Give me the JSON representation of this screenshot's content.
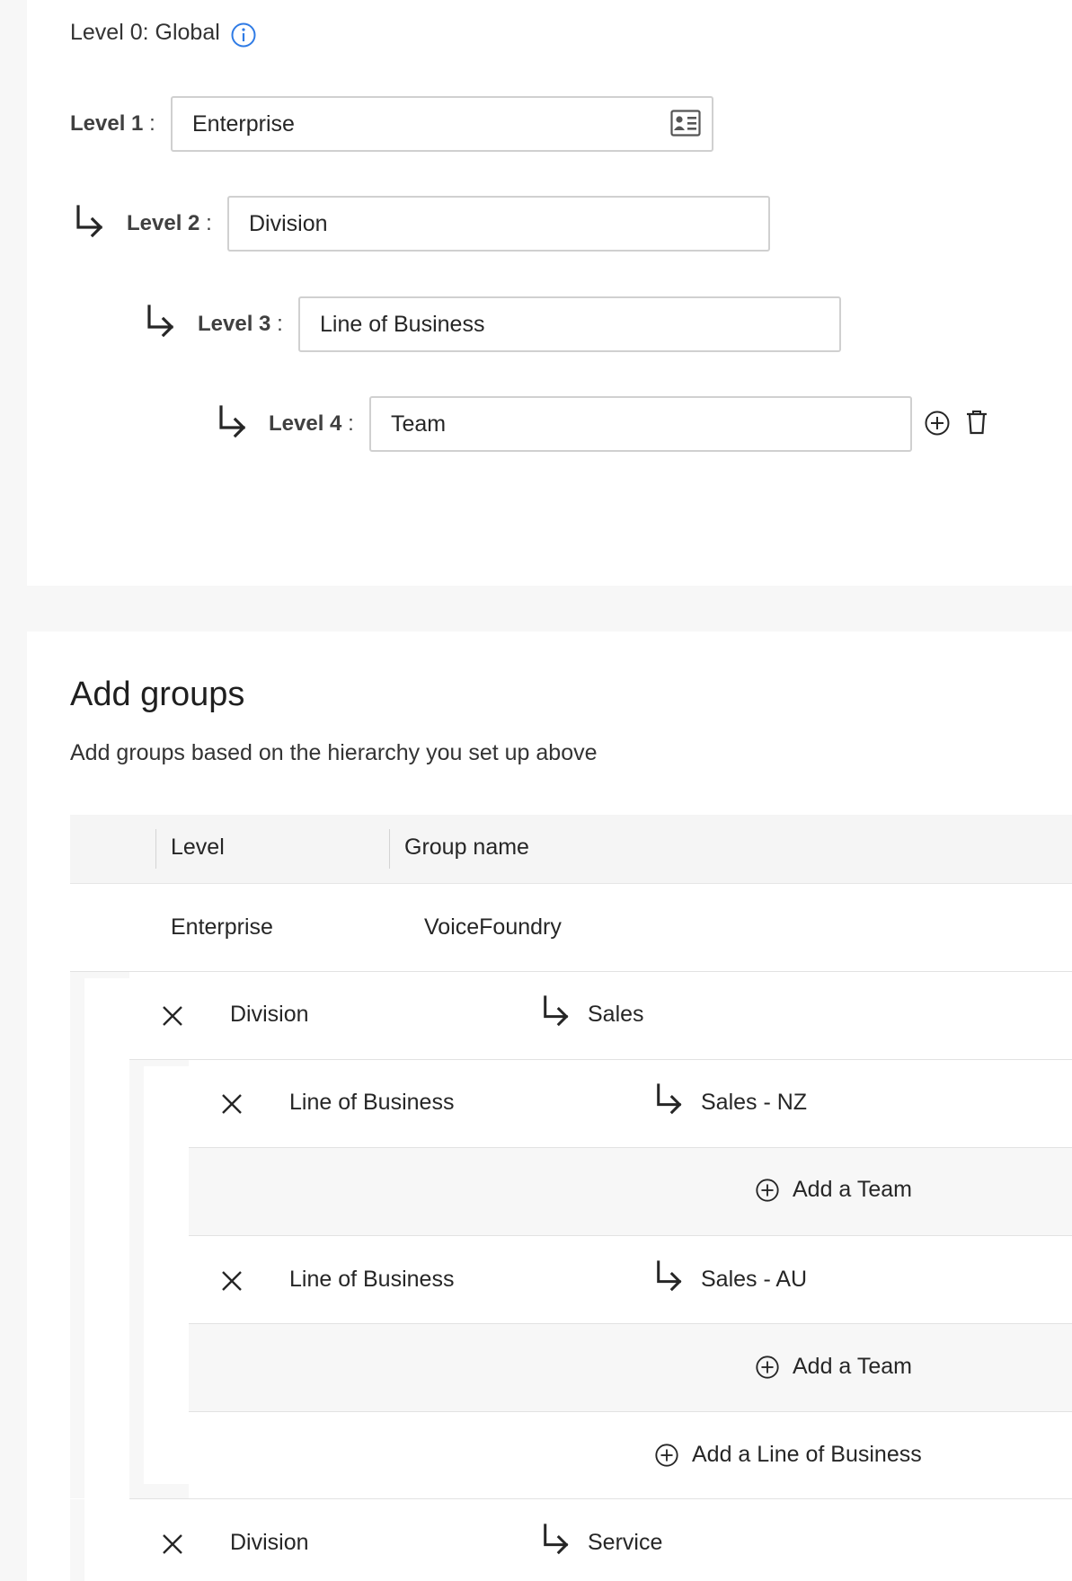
{
  "hierarchy": {
    "level0": {
      "label": "Level 0: Global"
    },
    "levels": [
      {
        "label": "Level 1",
        "value": "Enterprise"
      },
      {
        "label": "Level 2",
        "value": "Division"
      },
      {
        "label": "Level 3",
        "value": "Line of Business"
      },
      {
        "label": "Level 4",
        "value": "Team"
      }
    ],
    "colon": ":"
  },
  "groups": {
    "title": "Add groups",
    "subtitle": "Add groups based on the hierarchy you set up above",
    "columns": {
      "level": "Level",
      "group_name": "Group name"
    },
    "rows": {
      "enterprise": {
        "level": "Enterprise",
        "name": "VoiceFoundry"
      },
      "division_sales": {
        "level": "Division",
        "name": "Sales"
      },
      "lob_nz": {
        "level": "Line of Business",
        "name": "Sales - NZ"
      },
      "add_team_1": {
        "label": "Add a Team"
      },
      "lob_au": {
        "level": "Line of Business",
        "name": "Sales - AU"
      },
      "add_team_2": {
        "label": "Add a Team"
      },
      "add_lob": {
        "label": "Add a Line of Business"
      },
      "division_service": {
        "level": "Division",
        "name": "Service"
      }
    }
  },
  "colors": {
    "info_accent": "#2f7be5",
    "panel_bg": "#ffffff",
    "page_bg": "#f7f7f7",
    "band_bg": "#f7f7f7"
  }
}
